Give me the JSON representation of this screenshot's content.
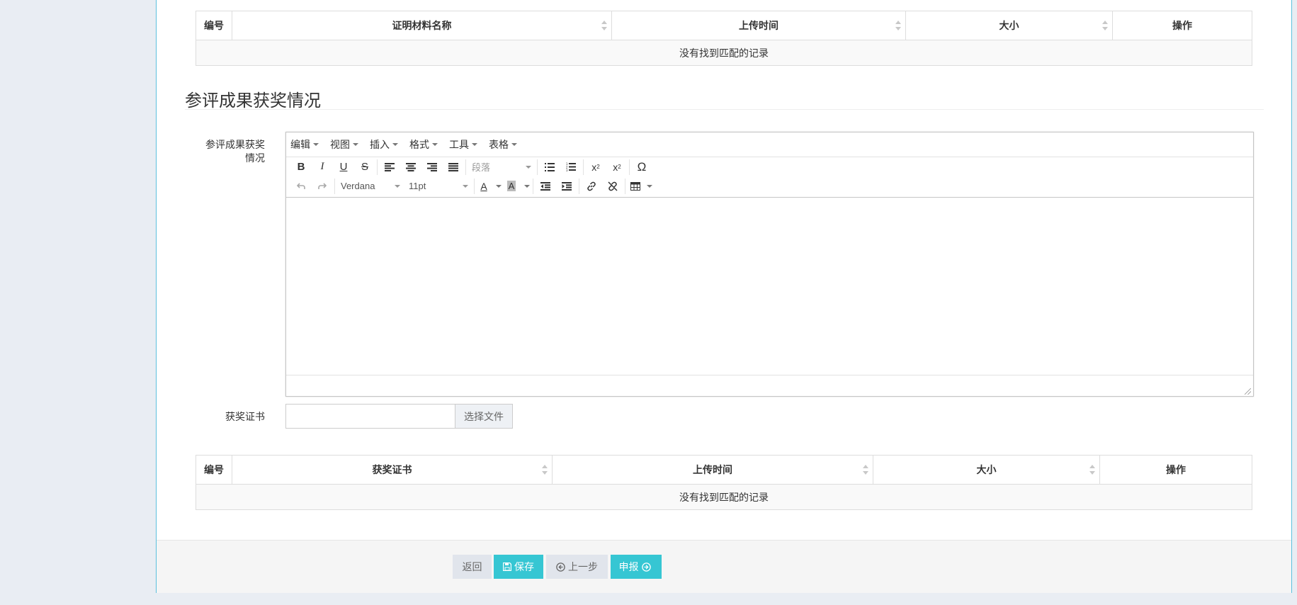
{
  "materials_table": {
    "headers": [
      "编号",
      "证明材料名称",
      "上传时间",
      "大小",
      "操作"
    ],
    "empty_text": "没有找到匹配的记录"
  },
  "section": {
    "title": "参评成果获奖情况"
  },
  "form": {
    "awards_label": "参评成果获奖情况",
    "certificate_label": "获奖证书",
    "choose_file_label": "选择文件"
  },
  "editor": {
    "menus": [
      "编辑",
      "视图",
      "插入",
      "格式",
      "工具",
      "表格"
    ],
    "paragraph_select": "段落",
    "font_family": "Verdana",
    "font_size": "11pt",
    "content": ""
  },
  "certificate_table": {
    "headers": [
      "编号",
      "获奖证书",
      "上传时间",
      "大小",
      "操作"
    ],
    "empty_text": "没有找到匹配的记录"
  },
  "footer": {
    "back_label": "返回",
    "save_label": "保存",
    "prev_label": "上一步",
    "submit_label": "申报"
  },
  "colors": {
    "accent": "#36c6d3",
    "panel_border": "#5bc0de",
    "page_bg": "#e9edf3"
  }
}
